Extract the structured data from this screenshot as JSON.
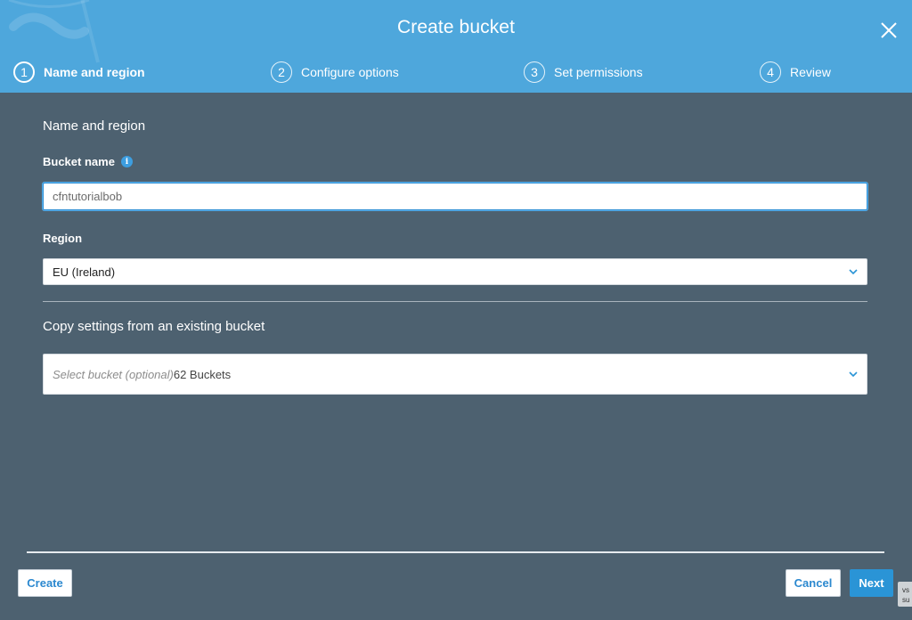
{
  "header": {
    "title": "Create bucket",
    "steps": [
      {
        "number": "1",
        "label": "Name and region",
        "active": true
      },
      {
        "number": "2",
        "label": "Configure options",
        "active": false
      },
      {
        "number": "3",
        "label": "Set permissions",
        "active": false
      },
      {
        "number": "4",
        "label": "Review",
        "active": false
      }
    ]
  },
  "form": {
    "section_title": "Name and region",
    "bucket_name_label": "Bucket name",
    "bucket_name_value": "cfntutorialbob",
    "region_label": "Region",
    "region_value": "EU (Ireland)",
    "copy_section_title": "Copy settings from an existing bucket",
    "copy_select_placeholder": "Select bucket (optional)",
    "copy_select_count": "62 Buckets"
  },
  "footer": {
    "create_label": "Create",
    "cancel_label": "Cancel",
    "next_label": "Next"
  },
  "corner_tip": {
    "line1": "vs",
    "line2": "su"
  },
  "colors": {
    "header_bg": "#4ea7dc",
    "body_bg": "#4d6170",
    "accent": "#2a94d6"
  }
}
